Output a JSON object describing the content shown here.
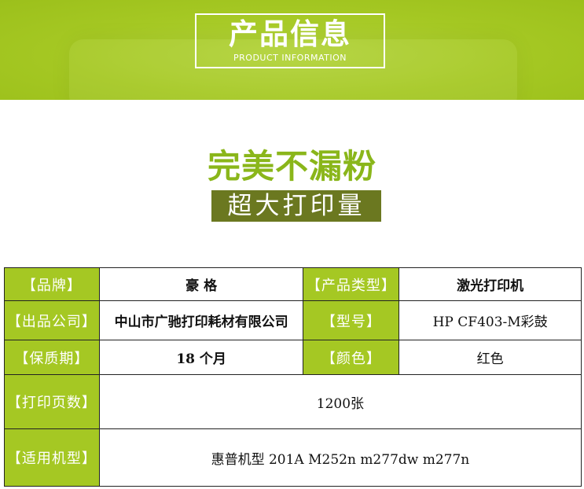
{
  "banner": {
    "title_cn": "产品信息",
    "title_en": "PRODUCT INFORMATION"
  },
  "slogan": {
    "line1": "完美不漏粉",
    "line2": "超大打印量"
  },
  "specs": {
    "brand_label": "【品牌】",
    "brand_value": "豪 格",
    "type_label": "【产品类型】",
    "type_value": "激光打印机",
    "company_label": "【出品公司】",
    "company_value": "中山市广驰打印耗材有限公司",
    "model_label": "【型号】",
    "model_value": "HP CF403-M彩鼓",
    "warranty_label": "【保质期】",
    "warranty_value": "18 个月",
    "color_label": "【颜色】",
    "color_value": "红色",
    "pages_label": "【打印页数】",
    "pages_value": "1200张",
    "compat_label": "【适用机型】",
    "compat_value": "惠普机型 201A M252n m277dw m277n"
  },
  "colors": {
    "brand_green": "#a5c823",
    "slogan_green": "#8ab61a",
    "slogan_dark_bg": "#6b7820"
  }
}
